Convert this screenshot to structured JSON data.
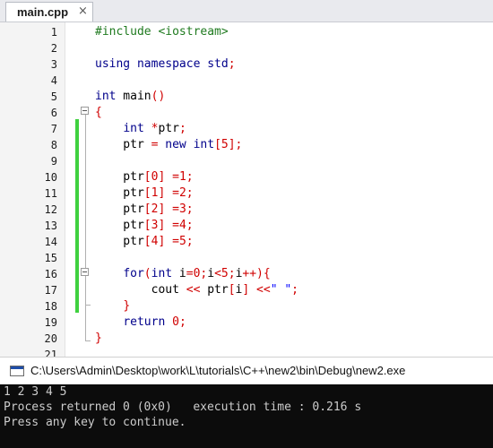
{
  "tab": {
    "label": "main.cpp",
    "close": "×"
  },
  "colors": {
    "keyword": "#00008b",
    "preprocessor": "#1f7a1f",
    "type": "#00008b",
    "operator": "#d00000",
    "number": "#d00000",
    "string": "#0000ff",
    "default": "#000000",
    "change_marker": "#3fd13f"
  },
  "editor": {
    "lines": [
      {
        "n": "1",
        "tokens": [
          {
            "t": "#include <iostream>",
            "k": "preprocessor"
          }
        ]
      },
      {
        "n": "2",
        "tokens": []
      },
      {
        "n": "3",
        "tokens": [
          {
            "t": "using namespace std",
            "k": "keyword"
          },
          {
            "t": ";",
            "k": "operator"
          }
        ]
      },
      {
        "n": "4",
        "tokens": []
      },
      {
        "n": "5",
        "tokens": [
          {
            "t": "int",
            "k": "type"
          },
          {
            "t": " main",
            "k": "default"
          },
          {
            "t": "()",
            "k": "operator"
          }
        ]
      },
      {
        "n": "6",
        "tokens": [
          {
            "t": "{",
            "k": "operator"
          }
        ]
      },
      {
        "n": "7",
        "tokens": [
          {
            "t": "    ",
            "k": "default"
          },
          {
            "t": "int",
            "k": "type"
          },
          {
            "t": " ",
            "k": "default"
          },
          {
            "t": "*",
            "k": "operator"
          },
          {
            "t": "ptr",
            "k": "default"
          },
          {
            "t": ";",
            "k": "operator"
          }
        ]
      },
      {
        "n": "8",
        "tokens": [
          {
            "t": "    ptr ",
            "k": "default"
          },
          {
            "t": "=",
            "k": "operator"
          },
          {
            "t": " ",
            "k": "default"
          },
          {
            "t": "new int",
            "k": "keyword"
          },
          {
            "t": "[",
            "k": "operator"
          },
          {
            "t": "5",
            "k": "number"
          },
          {
            "t": "];",
            "k": "operator"
          }
        ]
      },
      {
        "n": "9",
        "tokens": []
      },
      {
        "n": "10",
        "tokens": [
          {
            "t": "    ptr",
            "k": "default"
          },
          {
            "t": "[",
            "k": "operator"
          },
          {
            "t": "0",
            "k": "number"
          },
          {
            "t": "] =",
            "k": "operator"
          },
          {
            "t": "1",
            "k": "number"
          },
          {
            "t": ";",
            "k": "operator"
          }
        ]
      },
      {
        "n": "11",
        "tokens": [
          {
            "t": "    ptr",
            "k": "default"
          },
          {
            "t": "[",
            "k": "operator"
          },
          {
            "t": "1",
            "k": "number"
          },
          {
            "t": "] =",
            "k": "operator"
          },
          {
            "t": "2",
            "k": "number"
          },
          {
            "t": ";",
            "k": "operator"
          }
        ]
      },
      {
        "n": "12",
        "tokens": [
          {
            "t": "    ptr",
            "k": "default"
          },
          {
            "t": "[",
            "k": "operator"
          },
          {
            "t": "2",
            "k": "number"
          },
          {
            "t": "] =",
            "k": "operator"
          },
          {
            "t": "3",
            "k": "number"
          },
          {
            "t": ";",
            "k": "operator"
          }
        ]
      },
      {
        "n": "13",
        "tokens": [
          {
            "t": "    ptr",
            "k": "default"
          },
          {
            "t": "[",
            "k": "operator"
          },
          {
            "t": "3",
            "k": "number"
          },
          {
            "t": "] =",
            "k": "operator"
          },
          {
            "t": "4",
            "k": "number"
          },
          {
            "t": ";",
            "k": "operator"
          }
        ]
      },
      {
        "n": "14",
        "tokens": [
          {
            "t": "    ptr",
            "k": "default"
          },
          {
            "t": "[",
            "k": "operator"
          },
          {
            "t": "4",
            "k": "number"
          },
          {
            "t": "] =",
            "k": "operator"
          },
          {
            "t": "5",
            "k": "number"
          },
          {
            "t": ";",
            "k": "operator"
          }
        ]
      },
      {
        "n": "15",
        "tokens": []
      },
      {
        "n": "16",
        "tokens": [
          {
            "t": "    ",
            "k": "default"
          },
          {
            "t": "for",
            "k": "keyword"
          },
          {
            "t": "(",
            "k": "operator"
          },
          {
            "t": "int",
            "k": "type"
          },
          {
            "t": " i",
            "k": "default"
          },
          {
            "t": "=",
            "k": "operator"
          },
          {
            "t": "0",
            "k": "number"
          },
          {
            "t": ";",
            "k": "operator"
          },
          {
            "t": "i",
            "k": "default"
          },
          {
            "t": "<",
            "k": "operator"
          },
          {
            "t": "5",
            "k": "number"
          },
          {
            "t": ";",
            "k": "operator"
          },
          {
            "t": "i",
            "k": "default"
          },
          {
            "t": "++){",
            "k": "operator"
          }
        ]
      },
      {
        "n": "17",
        "tokens": [
          {
            "t": "        cout ",
            "k": "default"
          },
          {
            "t": "<<",
            "k": "operator"
          },
          {
            "t": " ptr",
            "k": "default"
          },
          {
            "t": "[",
            "k": "operator"
          },
          {
            "t": "i",
            "k": "default"
          },
          {
            "t": "]",
            "k": "operator"
          },
          {
            "t": " ",
            "k": "default"
          },
          {
            "t": "<<",
            "k": "operator"
          },
          {
            "t": "\" \"",
            "k": "string"
          },
          {
            "t": ";",
            "k": "operator"
          }
        ]
      },
      {
        "n": "18",
        "tokens": [
          {
            "t": "    ",
            "k": "default"
          },
          {
            "t": "}",
            "k": "operator"
          }
        ]
      },
      {
        "n": "19",
        "tokens": [
          {
            "t": "    ",
            "k": "default"
          },
          {
            "t": "return",
            "k": "keyword"
          },
          {
            "t": " ",
            "k": "default"
          },
          {
            "t": "0",
            "k": "number"
          },
          {
            "t": ";",
            "k": "operator"
          }
        ]
      },
      {
        "n": "20",
        "tokens": [
          {
            "t": "}",
            "k": "operator"
          }
        ]
      },
      {
        "n": "21",
        "tokens": []
      }
    ]
  },
  "console": {
    "title": "C:\\Users\\Admin\\Desktop\\work\\L\\tutorials\\C++\\new2\\bin\\Debug\\new2.exe",
    "lines": [
      "1 2 3 4 5",
      "Process returned 0 (0x0)   execution time : 0.216 s",
      "Press any key to continue."
    ]
  }
}
